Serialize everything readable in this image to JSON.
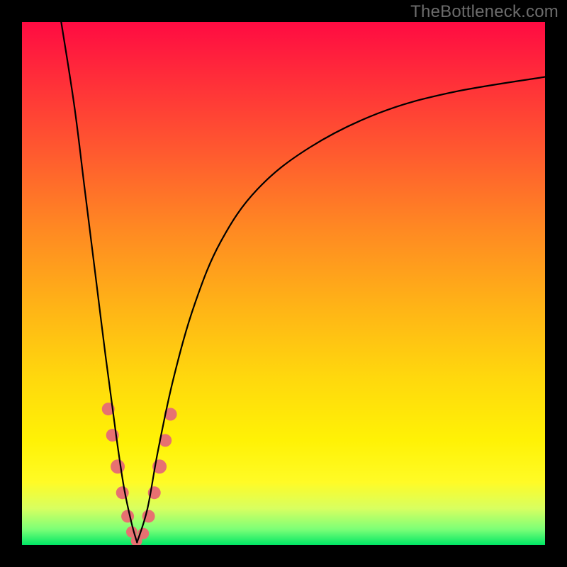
{
  "watermark": "TheBottleneck.com",
  "colors": {
    "frame": "#000000",
    "gradient_top": "#ff0b42",
    "gradient_mid1": "#ff8a22",
    "gradient_mid2": "#fff205",
    "gradient_bottom": "#00e765",
    "curve": "#000000",
    "dots": "#e77171",
    "watermark_text": "#6c6c6c"
  },
  "chart_data": {
    "type": "line",
    "title": "",
    "xlabel": "",
    "ylabel": "",
    "xlim": [
      0,
      100
    ],
    "ylim": [
      0,
      100
    ],
    "note": "Axes are unlabeled in the source image; values are in percent of the 738×738 plot area, origin at bottom-left. Two curves form a V with minimum near x≈22. Pink dots cluster along both branches near the minimum.",
    "series": [
      {
        "name": "left-branch",
        "x_pct": [
          7.5,
          10,
          12,
          14,
          16,
          18,
          19.5,
          21,
          22
        ],
        "y_pct": [
          100,
          84,
          68,
          52,
          36,
          21,
          11,
          4,
          0.5
        ]
      },
      {
        "name": "right-branch",
        "x_pct": [
          22,
          24,
          26,
          29,
          33,
          38,
          45,
          55,
          68,
          82,
          100
        ],
        "y_pct": [
          0.5,
          7,
          18,
          32,
          46,
          58,
          68,
          76,
          82.5,
          86.5,
          89.5
        ]
      }
    ],
    "dots_left_branch": [
      {
        "x_pct": 16.5,
        "y_pct": 26,
        "r": 9
      },
      {
        "x_pct": 17.3,
        "y_pct": 21,
        "r": 9
      },
      {
        "x_pct": 18.3,
        "y_pct": 15,
        "r": 10
      },
      {
        "x_pct": 19.2,
        "y_pct": 10,
        "r": 9
      },
      {
        "x_pct": 20.2,
        "y_pct": 5.5,
        "r": 9
      },
      {
        "x_pct": 21.0,
        "y_pct": 2.5,
        "r": 8
      },
      {
        "x_pct": 21.9,
        "y_pct": 0.8,
        "r": 8
      }
    ],
    "dots_right_branch": [
      {
        "x_pct": 23.2,
        "y_pct": 2.2,
        "r": 8
      },
      {
        "x_pct": 24.2,
        "y_pct": 5.5,
        "r": 9
      },
      {
        "x_pct": 25.3,
        "y_pct": 10,
        "r": 9
      },
      {
        "x_pct": 26.3,
        "y_pct": 15,
        "r": 10
      },
      {
        "x_pct": 27.4,
        "y_pct": 20,
        "r": 9
      },
      {
        "x_pct": 28.4,
        "y_pct": 25,
        "r": 9
      }
    ]
  }
}
